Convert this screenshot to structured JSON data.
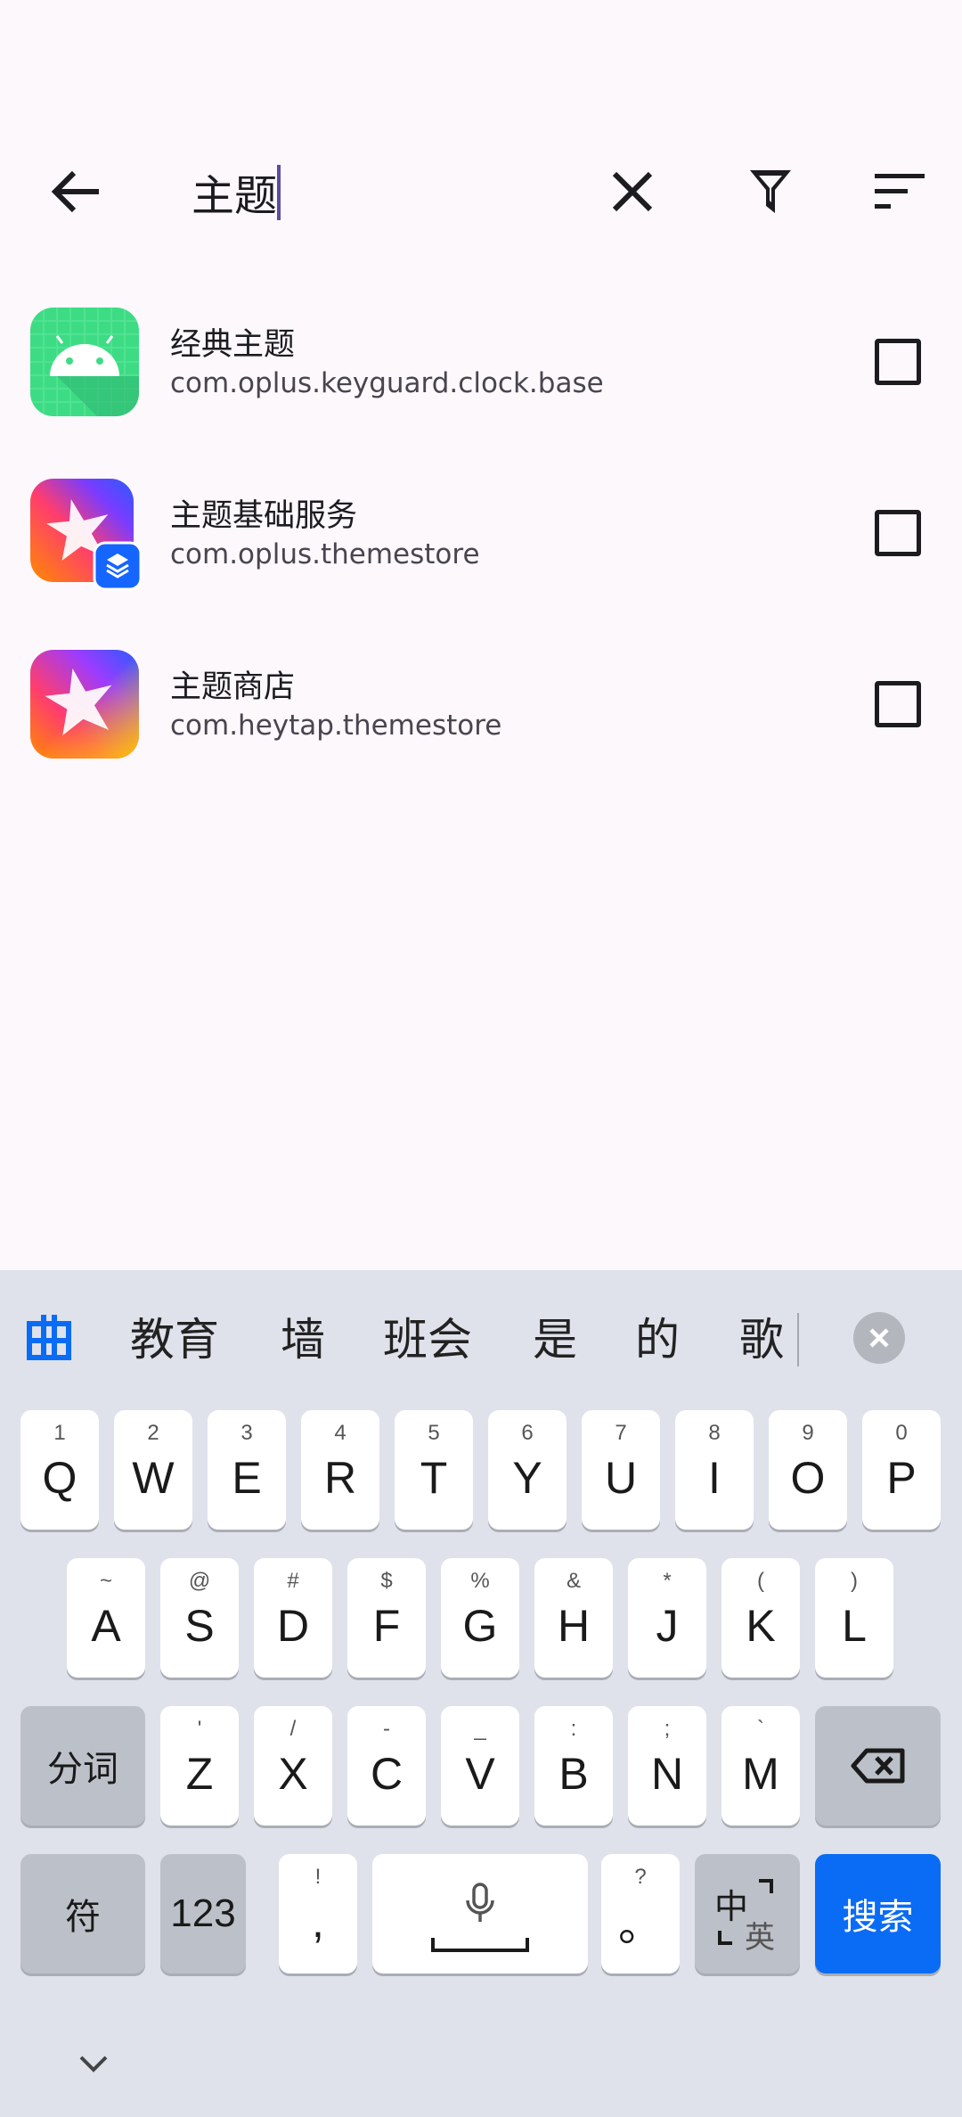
{
  "search": {
    "value": "主题"
  },
  "apps": [
    {
      "name": "经典主题",
      "package": "com.oplus.keyguard.clock.base",
      "icon": "android-icon"
    },
    {
      "name": "主题基础服务",
      "package": "com.oplus.themestore",
      "icon": "themestore-service-icon"
    },
    {
      "name": "主题商店",
      "package": "com.heytap.themestore",
      "icon": "themestore-icon"
    }
  ],
  "keyboard": {
    "candidates": [
      "教育",
      "墙",
      "班会",
      "是",
      "的",
      "歌"
    ],
    "row1": [
      {
        "hint": "1",
        "key": "Q"
      },
      {
        "hint": "2",
        "key": "W"
      },
      {
        "hint": "3",
        "key": "E"
      },
      {
        "hint": "4",
        "key": "R"
      },
      {
        "hint": "5",
        "key": "T"
      },
      {
        "hint": "6",
        "key": "Y"
      },
      {
        "hint": "7",
        "key": "U"
      },
      {
        "hint": "8",
        "key": "I"
      },
      {
        "hint": "9",
        "key": "O"
      },
      {
        "hint": "0",
        "key": "P"
      }
    ],
    "row2": [
      {
        "hint": "~",
        "key": "A"
      },
      {
        "hint": "@",
        "key": "S"
      },
      {
        "hint": "#",
        "key": "D"
      },
      {
        "hint": "$",
        "key": "F"
      },
      {
        "hint": "%",
        "key": "G"
      },
      {
        "hint": "&",
        "key": "H"
      },
      {
        "hint": "*",
        "key": "J"
      },
      {
        "hint": "(",
        "key": "K"
      },
      {
        "hint": ")",
        "key": "L"
      }
    ],
    "row3": [
      {
        "hint": "'",
        "key": "Z"
      },
      {
        "hint": "/",
        "key": "X"
      },
      {
        "hint": "-",
        "key": "C"
      },
      {
        "hint": "_",
        "key": "V"
      },
      {
        "hint": ":",
        "key": "B"
      },
      {
        "hint": ";",
        "key": "N"
      },
      {
        "hint": "`",
        "key": "M"
      }
    ],
    "segment_label": "分词",
    "symbols_label": "符",
    "numbers_label": "123",
    "comma": {
      "hint": "!",
      "key": ","
    },
    "period": {
      "hint": "?",
      "key": "。"
    },
    "lang_label_main": "中",
    "lang_label_sub": "英",
    "search_label": "搜索"
  },
  "colors": {
    "accent": "#0a6cf5",
    "keyboard_bg": "#dfe2ea",
    "page_bg": "#fcf8fc"
  }
}
